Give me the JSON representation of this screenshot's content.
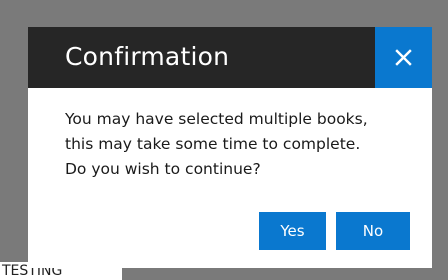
{
  "background": {
    "text": "TESTING"
  },
  "dialog": {
    "title": "Confirmation",
    "close_icon": "close-icon",
    "message_lines": [
      "You may have selected multiple books,",
      "this may take some time to complete.",
      "Do you wish to continue?"
    ],
    "buttons": {
      "yes_label": "Yes",
      "no_label": "No"
    },
    "colors": {
      "titlebar": "#262626",
      "accent": "#0a78cf",
      "overlay": "#7a7a7a"
    }
  }
}
